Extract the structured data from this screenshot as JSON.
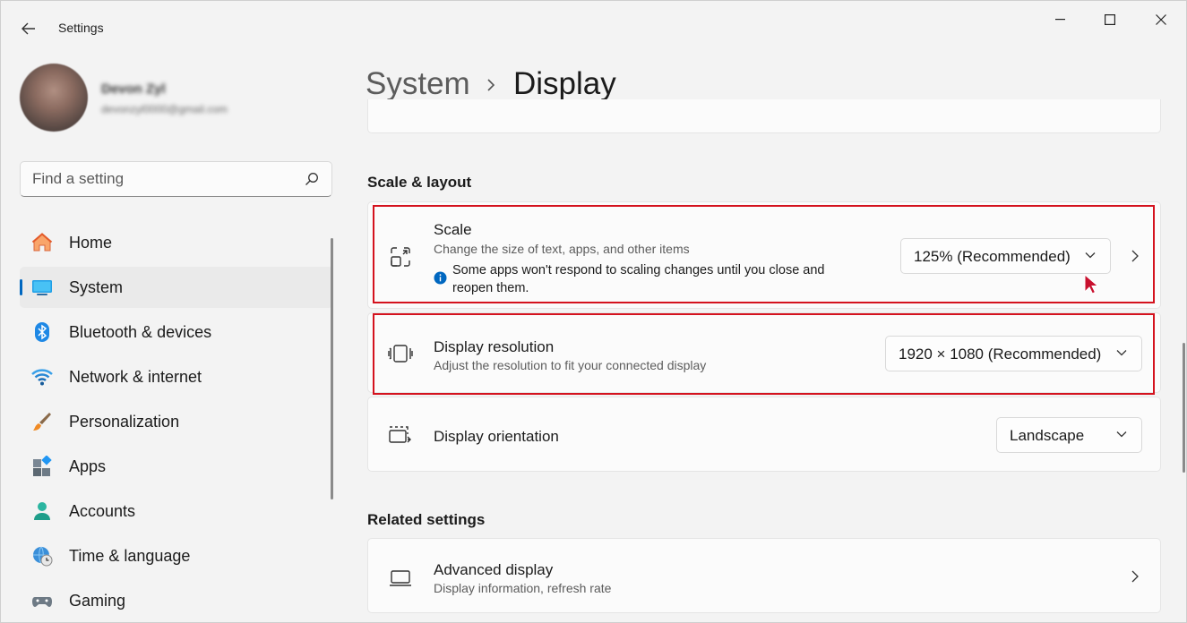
{
  "app": {
    "title": "Settings"
  },
  "profile": {
    "name": "Devon Zyl",
    "email": "devonzyl0000@gmail.com"
  },
  "search": {
    "placeholder": "Find a setting"
  },
  "nav": {
    "items": [
      {
        "label": "Home",
        "icon": "home-icon"
      },
      {
        "label": "System",
        "icon": "system-icon",
        "selected": true
      },
      {
        "label": "Bluetooth & devices",
        "icon": "bluetooth-icon"
      },
      {
        "label": "Network & internet",
        "icon": "wifi-icon"
      },
      {
        "label": "Personalization",
        "icon": "brush-icon"
      },
      {
        "label": "Apps",
        "icon": "apps-icon"
      },
      {
        "label": "Accounts",
        "icon": "person-icon"
      },
      {
        "label": "Time & language",
        "icon": "globe-clock-icon"
      },
      {
        "label": "Gaming",
        "icon": "controller-icon"
      }
    ]
  },
  "breadcrumb": {
    "parent": "System",
    "current": "Display"
  },
  "scale_layout": {
    "title": "Scale & layout",
    "scale": {
      "title": "Scale",
      "subtitle": "Change the size of text, apps, and other items",
      "info": "Some apps won't respond to scaling changes until you close and reopen them.",
      "value": "125% (Recommended)"
    },
    "resolution": {
      "title": "Display resolution",
      "subtitle": "Adjust the resolution to fit your connected display",
      "value": "1920 × 1080 (Recommended)"
    },
    "orientation": {
      "title": "Display orientation",
      "value": "Landscape"
    }
  },
  "related": {
    "title": "Related settings",
    "advanced": {
      "title": "Advanced display",
      "subtitle": "Display information, refresh rate"
    }
  },
  "colors": {
    "accent": "#0067c0",
    "highlight": "#d4121e"
  }
}
